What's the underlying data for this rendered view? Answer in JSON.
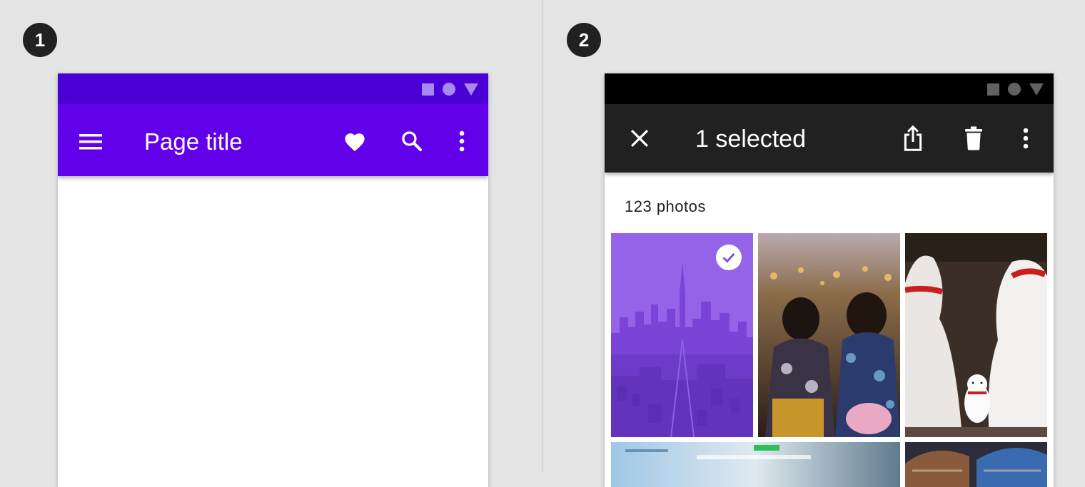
{
  "step_badges": [
    "1",
    "2"
  ],
  "screen1": {
    "status_bar_color": "#4b00d5",
    "app_bar_color": "#6200ea",
    "status_icon_color": "#a58bf0",
    "title": "Page title",
    "icons": [
      "menu-icon",
      "heart-icon",
      "search-icon",
      "more-vert-icon"
    ]
  },
  "screen2": {
    "status_bar_color": "#000000",
    "app_bar_color": "#212121",
    "status_icon_color": "#616161",
    "title": "1 selected",
    "icons": [
      "close-icon",
      "share-icon",
      "delete-icon",
      "more-vert-icon"
    ],
    "section_label": "123 photos",
    "photos": [
      {
        "subject": "city skyline with tower",
        "selected": true
      },
      {
        "subject": "women in yukata at festival",
        "selected": false
      },
      {
        "subject": "lucky cat figurines",
        "selected": false
      },
      {
        "subject": "blurred motion street",
        "selected": false
      },
      {
        "subject": "knit hats",
        "selected": false
      }
    ],
    "selection_overlay_color": "#7c4dff"
  }
}
